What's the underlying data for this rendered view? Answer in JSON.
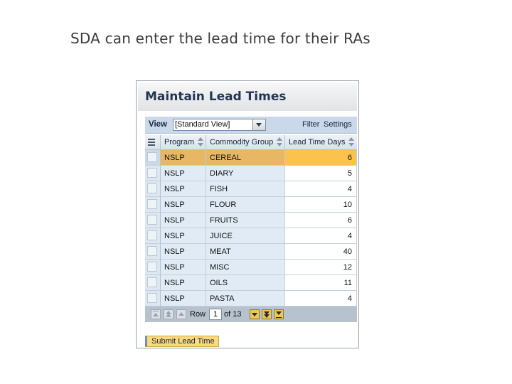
{
  "slide": {
    "title": "SDA can enter the lead time for their RAs"
  },
  "window": {
    "title": "Maintain Lead Times"
  },
  "toolbar": {
    "view_label": "View",
    "view_selected": "[Standard View]",
    "filter_label": "Filter",
    "settings_label": "Settings"
  },
  "table": {
    "columns": [
      "Program",
      "Commodity Group",
      "Lead Time Days"
    ],
    "rows": [
      {
        "program": "NSLP",
        "commodity": "CEREAL",
        "lead_days": "6",
        "selected": true
      },
      {
        "program": "NSLP",
        "commodity": "DIARY",
        "lead_days": "5",
        "selected": false
      },
      {
        "program": "NSLP",
        "commodity": "FISH",
        "lead_days": "4",
        "selected": false
      },
      {
        "program": "NSLP",
        "commodity": "FLOUR",
        "lead_days": "10",
        "selected": false
      },
      {
        "program": "NSLP",
        "commodity": "FRUITS",
        "lead_days": "6",
        "selected": false
      },
      {
        "program": "NSLP",
        "commodity": "JUICE",
        "lead_days": "4",
        "selected": false
      },
      {
        "program": "NSLP",
        "commodity": "MEAT",
        "lead_days": "40",
        "selected": false
      },
      {
        "program": "NSLP",
        "commodity": "MISC",
        "lead_days": "12",
        "selected": false
      },
      {
        "program": "NSLP",
        "commodity": "OILS",
        "lead_days": "11",
        "selected": false
      },
      {
        "program": "NSLP",
        "commodity": "PASTA",
        "lead_days": "4",
        "selected": false
      }
    ]
  },
  "pager": {
    "row_label": "Row",
    "row_value": "1",
    "of_label": "of 13"
  },
  "submit": {
    "label": "Submit Lead Time"
  },
  "colors": {
    "selected_row": "#e7b766",
    "selected_cell": "#fbc34e",
    "toolbar": "#c9d9ea",
    "submit_button": "#fbd97e"
  }
}
